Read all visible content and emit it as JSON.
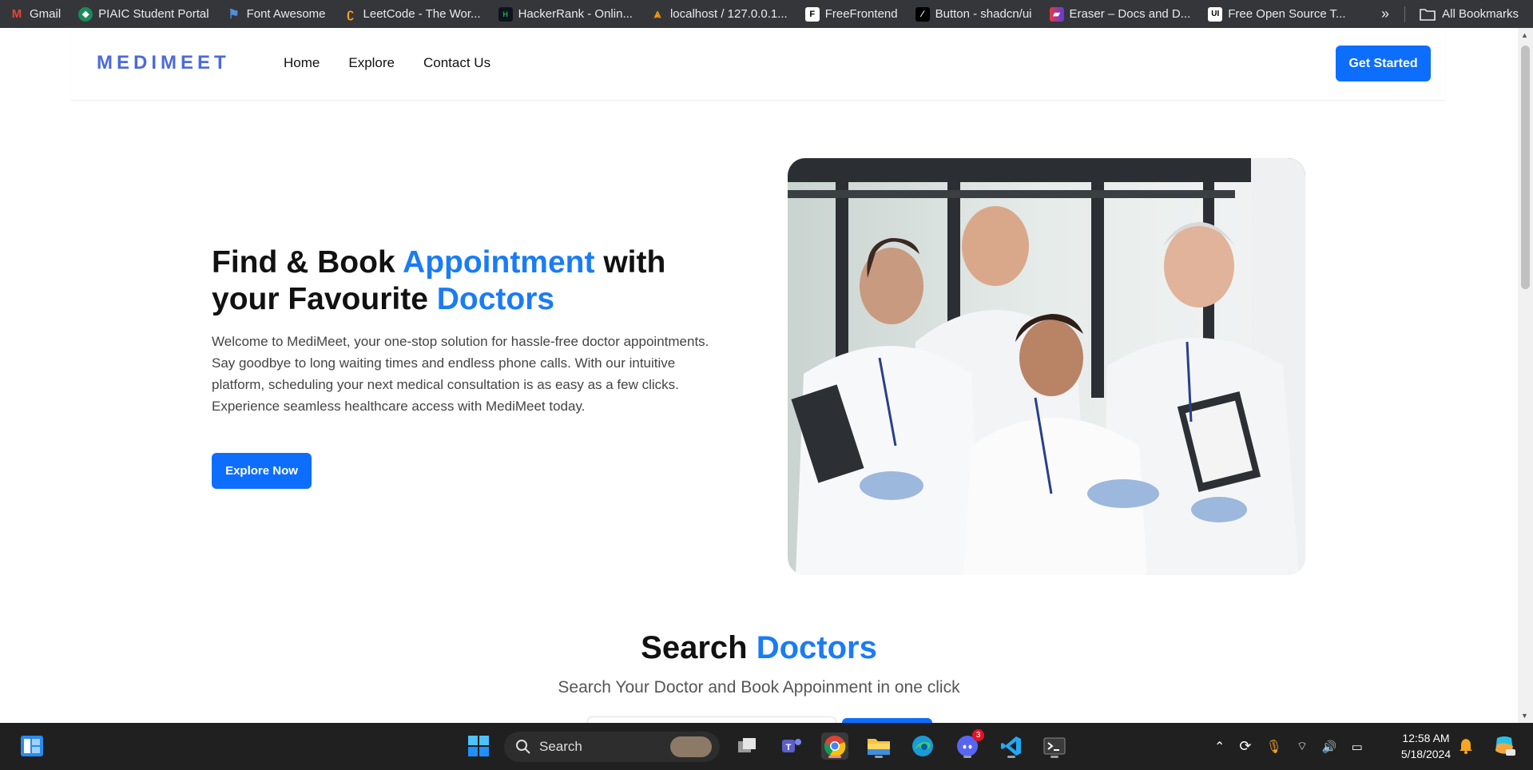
{
  "bookmarks": {
    "items": [
      {
        "label": "Gmail",
        "icon": "gmail-icon",
        "color": "#ea4335"
      },
      {
        "label": "PIAIC Student Portal",
        "icon": "piaic-icon",
        "color": "#1b8a5a"
      },
      {
        "label": "Font Awesome",
        "icon": "font-awesome-icon",
        "color": "#538dd7"
      },
      {
        "label": "LeetCode - The Wor...",
        "icon": "leetcode-icon",
        "color": "#ffa116"
      },
      {
        "label": "HackerRank - Onlin...",
        "icon": "hackerrank-icon",
        "color": "#1ba94c"
      },
      {
        "label": "localhost / 127.0.0.1...",
        "icon": "phpmyadmin-icon",
        "color": "#f89c0e"
      },
      {
        "label": "FreeFrontend",
        "icon": "freefrontend-icon",
        "color": "#ffffff"
      },
      {
        "label": "Button - shadcn/ui",
        "icon": "shadcn-icon",
        "color": "#000000"
      },
      {
        "label": "Eraser – Docs and D...",
        "icon": "eraser-icon",
        "color": "#e63b3b"
      },
      {
        "label": "Free Open Source T...",
        "icon": "ui-icon",
        "color": "#ffffff"
      }
    ],
    "more": "»",
    "all_bookmarks": "All Bookmarks"
  },
  "navbar": {
    "logo": "MEDIMEET",
    "links": [
      "Home",
      "Explore",
      "Contact Us"
    ],
    "cta": "Get Started"
  },
  "hero": {
    "title_part1": "Find & Book ",
    "title_accent1": "Appointment",
    "title_part2": " with your Favourite ",
    "title_accent2": "Doctors",
    "description": "Welcome to MediMeet, your one-stop solution for hassle-free doctor appointments. Say goodbye to long waiting times and endless phone calls. With our intuitive platform, scheduling your next medical consultation is as easy as a few clicks. Experience seamless healthcare access with MediMeet today.",
    "button": "Explore Now"
  },
  "search_section": {
    "title_part1": "Search ",
    "title_accent": "Doctors",
    "subtitle": "Search Your Doctor and Book Appoinment in one click"
  },
  "taskbar": {
    "search_placeholder": "Search",
    "time": "12:58 AM",
    "date": "5/18/2024",
    "discord_badge": "3"
  },
  "colors": {
    "accent": "#1a7cf5",
    "primary_button": "#0d6efd",
    "logo": "#4a6bd8"
  }
}
